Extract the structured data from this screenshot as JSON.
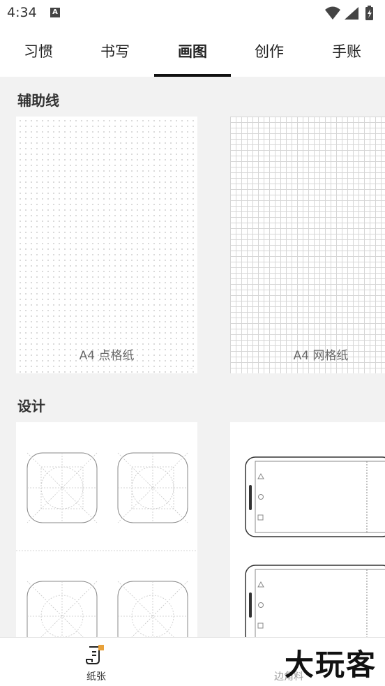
{
  "status": {
    "time": "4:34",
    "notif_letter": "A"
  },
  "tabs": [
    {
      "label": "习惯"
    },
    {
      "label": "书写"
    },
    {
      "label": "画图"
    },
    {
      "label": "创作"
    },
    {
      "label": "手账"
    }
  ],
  "active_tab": "画图",
  "sections": {
    "guides": {
      "title": "辅助线",
      "cards": [
        {
          "label": "A4 点格纸"
        },
        {
          "label": "A4 网格纸"
        }
      ]
    },
    "design": {
      "title": "设计"
    }
  },
  "bottom_nav": {
    "paper_label": "纸张",
    "other_label": "边角料"
  },
  "watermark": "大玩客"
}
